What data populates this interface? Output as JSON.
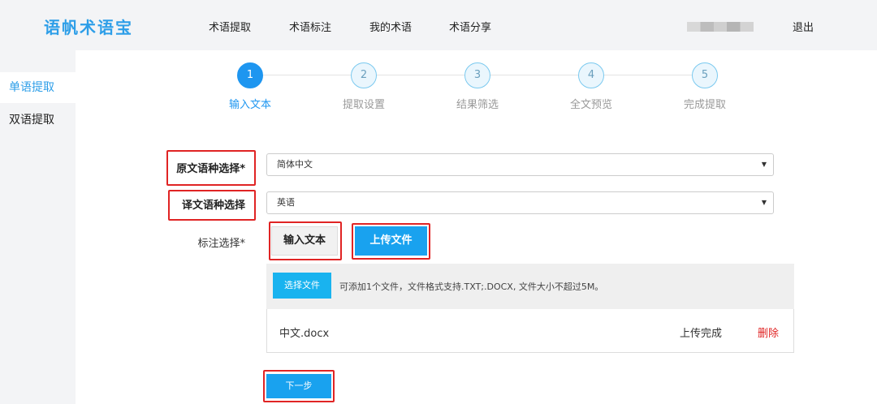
{
  "header": {
    "logo": "语帆术语宝",
    "nav": [
      "术语提取",
      "术语标注",
      "我的术语",
      "术语分享"
    ],
    "logout": "退出"
  },
  "sidebar": {
    "items": [
      {
        "label": "单语提取",
        "active": true
      },
      {
        "label": "双语提取",
        "active": false
      }
    ]
  },
  "steps": [
    {
      "num": "1",
      "label": "输入文本",
      "active": true
    },
    {
      "num": "2",
      "label": "提取设置",
      "active": false
    },
    {
      "num": "3",
      "label": "结果筛选",
      "active": false
    },
    {
      "num": "4",
      "label": "全文预览",
      "active": false
    },
    {
      "num": "5",
      "label": "完成提取",
      "active": false
    }
  ],
  "form": {
    "source_label": "原文语种选择*",
    "source_value": "简体中文",
    "target_label": "译文语种选择",
    "target_value": "英语",
    "annotate_label": "标注选择*",
    "btn_input_text": "输入文本",
    "btn_upload_file": "上传文件"
  },
  "upload": {
    "choose_label": "选择文件",
    "hint": "可添加1个文件，文件格式支持.TXT;.DOCX, 文件大小不超过5M。",
    "file_name": "中文.docx",
    "file_status": "上传完成",
    "delete_label": "删除"
  },
  "next_label": "下一步",
  "colors": {
    "accent": "#1e96f0",
    "highlight": "#e02424"
  },
  "icons": {
    "select_caret": "▼"
  }
}
